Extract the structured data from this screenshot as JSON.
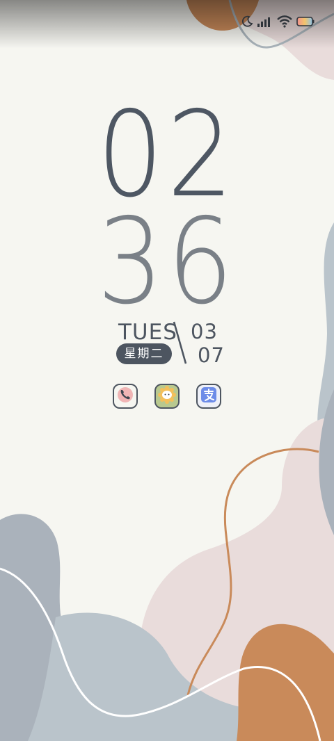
{
  "status_bar": {
    "icons": [
      "moon-icon",
      "signal-icon",
      "wifi-icon",
      "battery-icon"
    ]
  },
  "clock": {
    "hours": "02",
    "minutes": "36"
  },
  "date": {
    "weekday_en": "TUES",
    "weekday_cn": "星期二",
    "month": "03",
    "day": "07"
  },
  "shortcuts": [
    {
      "icon": "phone-icon"
    },
    {
      "icon": "chat-icon"
    },
    {
      "icon": "alipay-icon"
    }
  ],
  "colors": {
    "background": "#f6f6f1",
    "text_dark": "#4d5560",
    "text_light": "#7a8087",
    "accent_orange": "#c98a5a",
    "blob_gray": "#b9c3c8",
    "blob_pink": "#e9dcdb"
  }
}
